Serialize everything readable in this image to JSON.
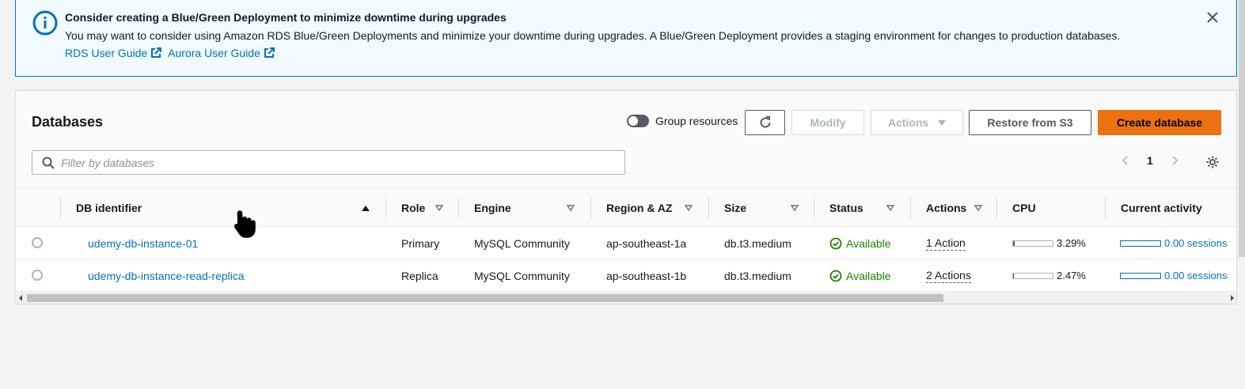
{
  "alert": {
    "title": "Consider creating a Blue/Green Deployment to minimize downtime during upgrades",
    "body": "You may want to consider using Amazon RDS Blue/Green Deployments and minimize your downtime during upgrades. A Blue/Green Deployment provides a staging environment for changes to production databases.",
    "links": [
      "RDS User Guide",
      "Aurora User Guide"
    ],
    "icon": "info-icon",
    "accent": "#0073bb"
  },
  "panel": {
    "title": "Databases",
    "group_resources_label": "Group resources",
    "buttons": {
      "modify": "Modify",
      "actions": "Actions",
      "restore": "Restore from S3",
      "create": "Create database"
    },
    "filter_placeholder": "Filter by databases",
    "page": "1"
  },
  "table": {
    "columns": [
      "DB identifier",
      "Role",
      "Engine",
      "Region & AZ",
      "Size",
      "Status",
      "Actions",
      "CPU",
      "Current activity"
    ],
    "rows": [
      {
        "identifier": "udemy-db-instance-01",
        "role": "Primary",
        "engine": "MySQL Community",
        "region": "ap-southeast-1a",
        "size": "db.t3.medium",
        "status": "Available",
        "actions": "1 Action",
        "cpu": "3.29%",
        "cpu_value": 3.29,
        "activity": "0.00 sessions"
      },
      {
        "identifier": "udemy-db-instance-read-replica",
        "role": "Replica",
        "engine": "MySQL Community",
        "region": "ap-southeast-1b",
        "size": "db.t3.medium",
        "status": "Available",
        "actions": "2 Actions",
        "cpu": "2.47%",
        "cpu_value": 2.47,
        "activity": "0.00 sessions"
      }
    ]
  },
  "colors": {
    "link": "#0073bb",
    "available": "#1d8102",
    "primary_button": "#ec7211"
  }
}
